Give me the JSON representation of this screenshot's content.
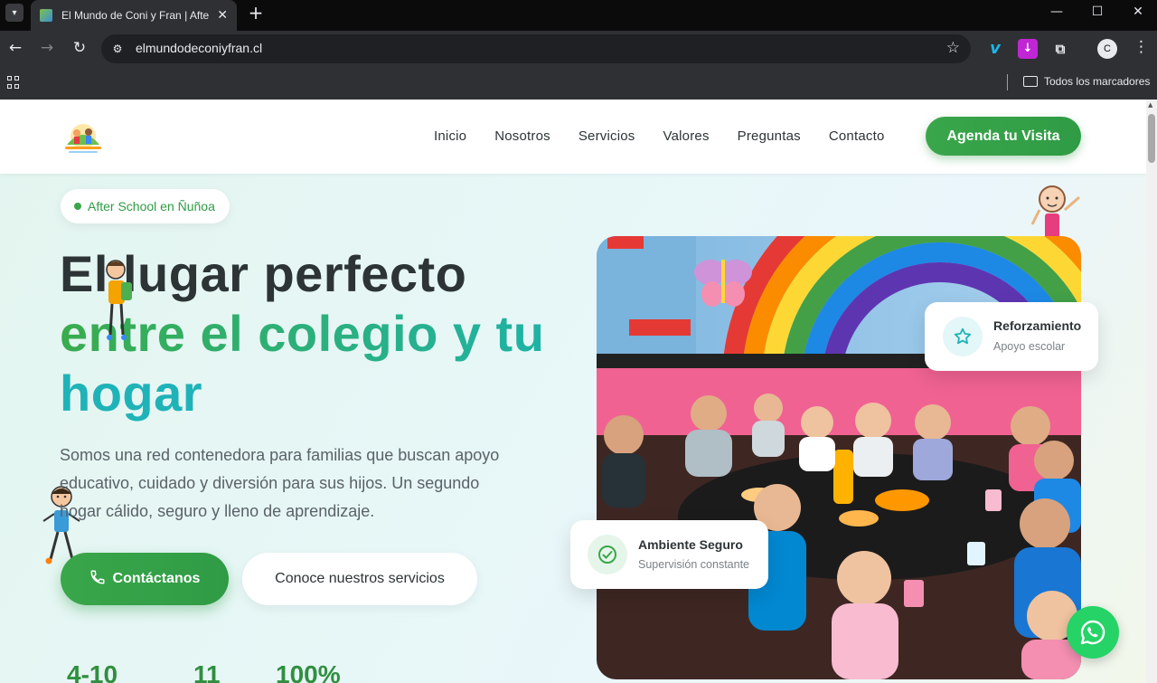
{
  "browser": {
    "tab_title": "El Mundo de Coni y Fran | After School",
    "url": "elmundodeconiyfran.cl",
    "profile_initial": "C",
    "bookmarks_label": "Todos los marcadores",
    "icons": [
      "tab-search-icon",
      "back-arrow-icon",
      "forward-arrow-icon",
      "reload-icon",
      "site-info-icon",
      "bookmark-star-icon",
      "vimeo-icon",
      "download-ext-icon",
      "puzzle-icon",
      "kebab-menu-icon",
      "apps-grid-icon",
      "folder-icon"
    ]
  },
  "header": {
    "nav": [
      "Inicio",
      "Nosotros",
      "Servicios",
      "Valores",
      "Preguntas",
      "Contacto"
    ],
    "cta": "Agenda tu Visita"
  },
  "hero": {
    "badge": "After School en Ñuñoa",
    "title_line1": "El lugar perfecto",
    "title_line2": "entre el colegio y tu",
    "title_line3": "hogar",
    "description": "Somos una red contenedora para familias que buscan apoyo educativo, cuidado y diversión para sus hijos. Un segundo hogar cálido, seguro y lleno de aprendizaje.",
    "primary_button": "Contáctanos",
    "secondary_button": "Conoce nuestros servicios",
    "stats": [
      "4-10",
      "11",
      "100%"
    ]
  },
  "cards": {
    "reinforce_title": "Reforzamiento",
    "reinforce_sub": "Apoyo escolar",
    "safe_title": "Ambiente Seguro",
    "safe_sub": "Supervisión constante"
  },
  "colors": {
    "brand_green": "#2f9b45",
    "teal": "#1fb3b8",
    "whatsapp": "#25d366"
  }
}
